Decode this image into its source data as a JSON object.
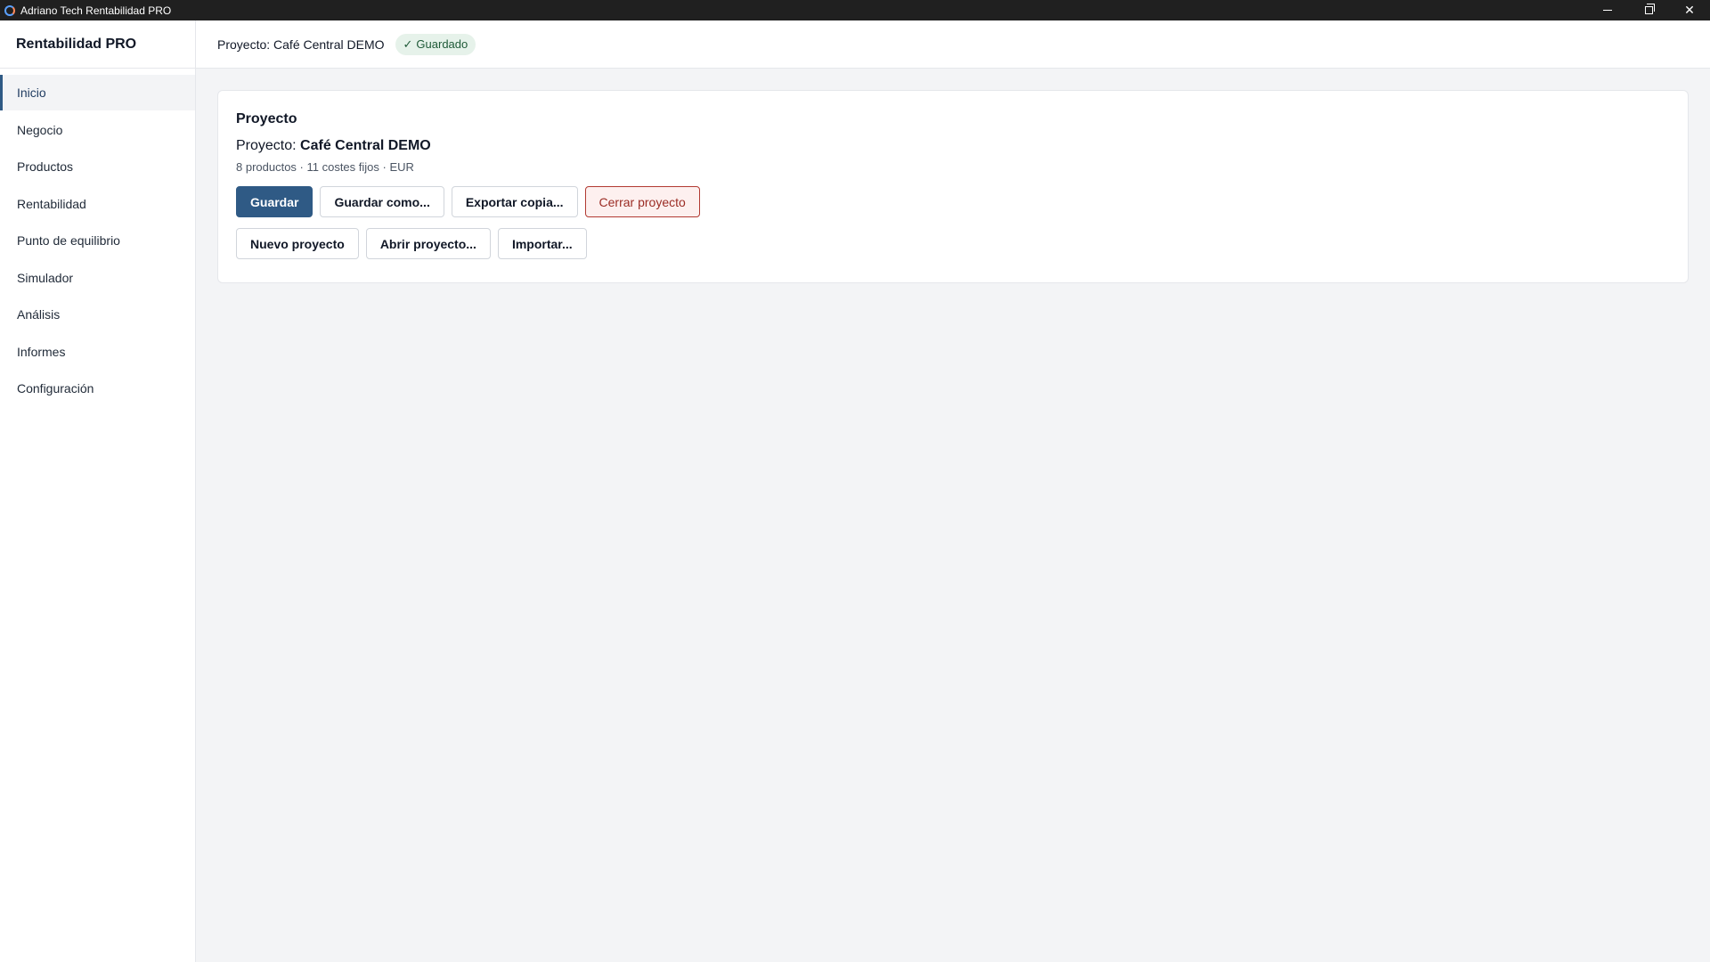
{
  "window": {
    "title": "Adriano Tech Rentabilidad PRO",
    "controls": {
      "minimize": "minimize",
      "restore": "restore",
      "close": "✕"
    }
  },
  "sidebar": {
    "brand": "Rentabilidad PRO",
    "items": [
      {
        "label": "Inicio",
        "active": true
      },
      {
        "label": "Negocio"
      },
      {
        "label": "Productos"
      },
      {
        "label": "Rentabilidad"
      },
      {
        "label": "Punto de equilibrio"
      },
      {
        "label": "Simulador"
      },
      {
        "label": "Análisis"
      },
      {
        "label": "Informes"
      },
      {
        "label": "Configuración"
      }
    ]
  },
  "header": {
    "project_label": "Proyecto: Café Central DEMO",
    "status_icon": "✓",
    "status_text": "Guardado",
    "status_color": "#1f5a38"
  },
  "card": {
    "title": "Proyecto",
    "project_prefix": "Proyecto: ",
    "project_name": "Café Central DEMO",
    "meta": "8 productos · 11 costes fijos · EUR",
    "buttons_row1": {
      "save": "Guardar",
      "save_as": "Guardar como...",
      "export": "Exportar copia...",
      "close": "Cerrar proyecto"
    },
    "buttons_row2": {
      "new": "Nuevo proyecto",
      "open": "Abrir proyecto...",
      "import": "Importar..."
    }
  },
  "colors": {
    "primary": "#2f5a85",
    "danger": "#b23a32",
    "sidebar_bg": "#ffffff",
    "content_bg": "#f3f4f6"
  }
}
